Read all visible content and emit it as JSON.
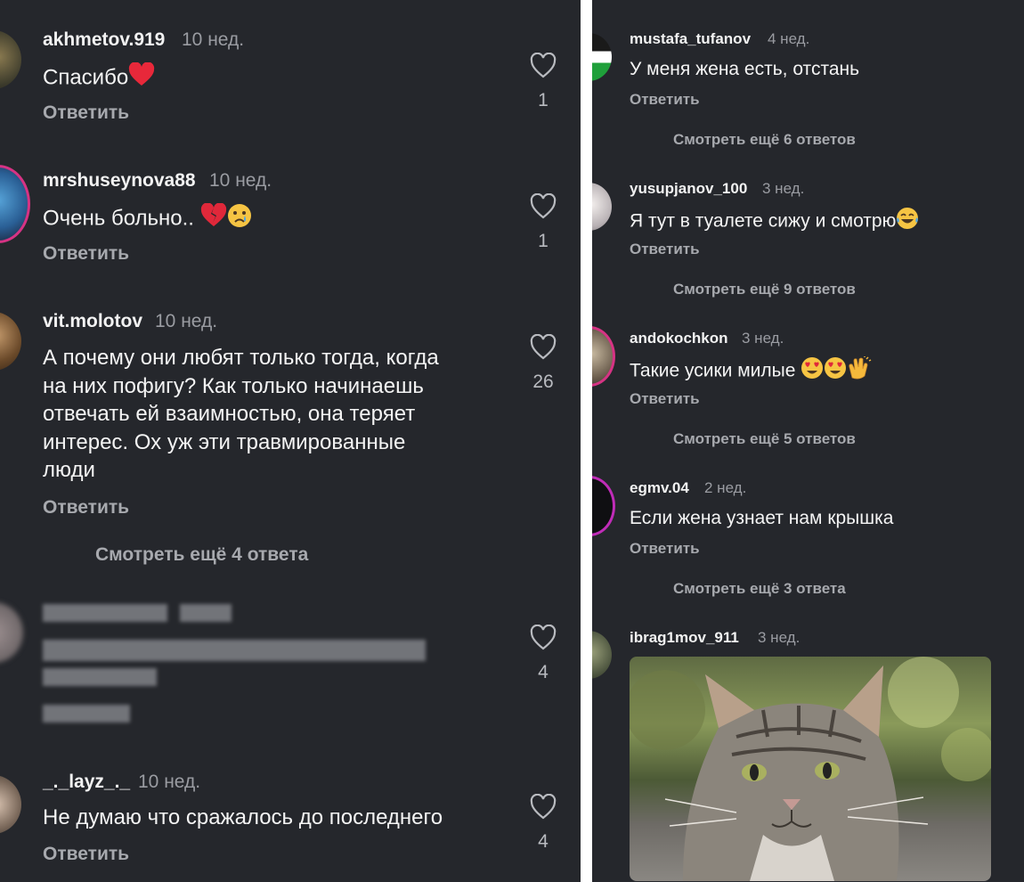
{
  "left_comments": [
    {
      "user": "akhmetov.919",
      "time": "10 нед.",
      "text": "Спасибо",
      "emoji": [
        "red-heart"
      ],
      "reply": "Ответить",
      "likes": "1"
    },
    {
      "user": "mrshuseynova88",
      "time": "10 нед.",
      "text": "Очень больно..",
      "emoji": [
        "broken-heart",
        "crying-face"
      ],
      "reply": "Ответить",
      "likes": "1"
    },
    {
      "user": "vit.molotov",
      "time": "10 нед.",
      "text_lines": [
        "А почему они любят только тогда, когда",
        "на них пофигу? Как только начинаешь",
        "отвечать ей взаимностью, она теряет",
        "интерес. Ох уж эти травмированные",
        "люди"
      ],
      "reply": "Ответить",
      "likes": "26",
      "more": "Смотреть ещё 4 ответа"
    },
    {
      "blurred": true,
      "likes": "4"
    },
    {
      "user": "_._layz_._",
      "time": "10 нед.",
      "text": "Не думаю что сражалось до последнего",
      "reply": "Ответить",
      "likes": "4"
    }
  ],
  "right_comments": [
    {
      "user": "mustafa_tufanov",
      "time": "4 нед.",
      "text": "У меня жена есть, отстань",
      "reply": "Ответить",
      "more": "Смотреть ещё 6 ответов"
    },
    {
      "user": "yusupjanov_100",
      "time": "3 нед.",
      "text": "Я тут в туалете сижу и смотрю",
      "emoji": [
        "tears-of-joy"
      ],
      "reply": "Ответить",
      "more": "Смотреть ещё 9 ответов"
    },
    {
      "user": "andokochkon",
      "time": "3 нед.",
      "text": "Такие усики милые",
      "emoji": [
        "heart-eyes",
        "heart-eyes",
        "clapping-hands"
      ],
      "reply": "Ответить",
      "more": "Смотреть ещё 5 ответов"
    },
    {
      "user": "egmv.04",
      "time": "2 нед.",
      "text": "Если жена узнает нам крышка",
      "reply": "Ответить",
      "more": "Смотреть ещё 3 ответа"
    },
    {
      "user": "ibrag1mov_911",
      "time": "3 нед.",
      "image": "cat-photo"
    }
  ],
  "colors": {
    "background": "#25272c",
    "text": "#f4f4f4",
    "muted": "#a7a9ae",
    "divider": "#ffffff"
  }
}
